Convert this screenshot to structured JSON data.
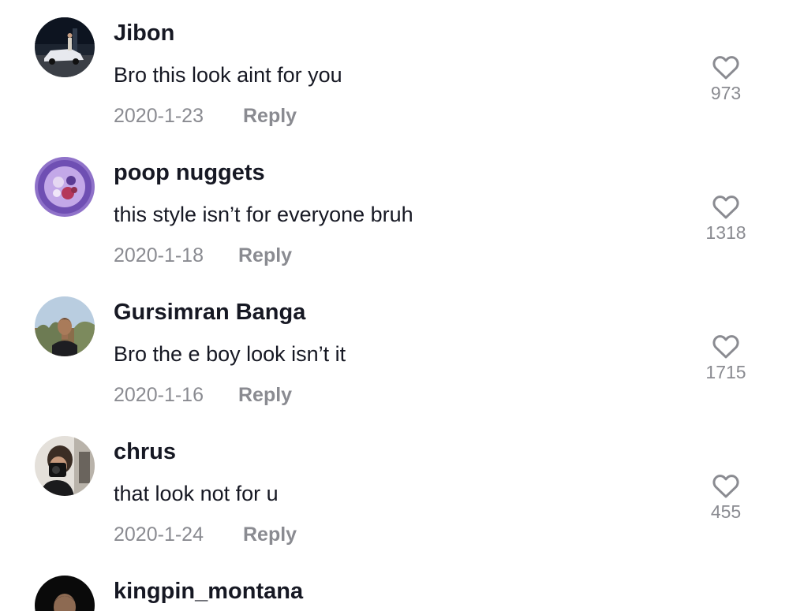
{
  "colors": {
    "text_primary": "#161823",
    "text_secondary": "#8a8b91",
    "background": "#ffffff"
  },
  "comments": [
    {
      "username": "Jibon",
      "text": "Bro this look aint for you",
      "date": "2020-1-23",
      "reply_label": "Reply",
      "likes": "973",
      "like_icon": "heart-outline-icon",
      "avatar_desc": "car photo"
    },
    {
      "username": "poop nuggets",
      "text": "this style isn’t for everyone bruh",
      "date": "2020-1-18",
      "reply_label": "Reply",
      "likes": "1318",
      "like_icon": "heart-outline-icon",
      "avatar_desc": "purple food bowl"
    },
    {
      "username": "Gursimran Banga",
      "text": "Bro the e boy look isn’t it",
      "date": "2020-1-16",
      "reply_label": "Reply",
      "likes": "1715",
      "like_icon": "heart-outline-icon",
      "avatar_desc": "person outdoors"
    },
    {
      "username": "chrus",
      "text": "that look not for u",
      "date": "2020-1-24",
      "reply_label": "Reply",
      "likes": "455",
      "like_icon": "heart-outline-icon",
      "avatar_desc": "mirror selfie"
    },
    {
      "username": "kingpin_montana",
      "avatar_desc": "man in dark suit"
    }
  ]
}
